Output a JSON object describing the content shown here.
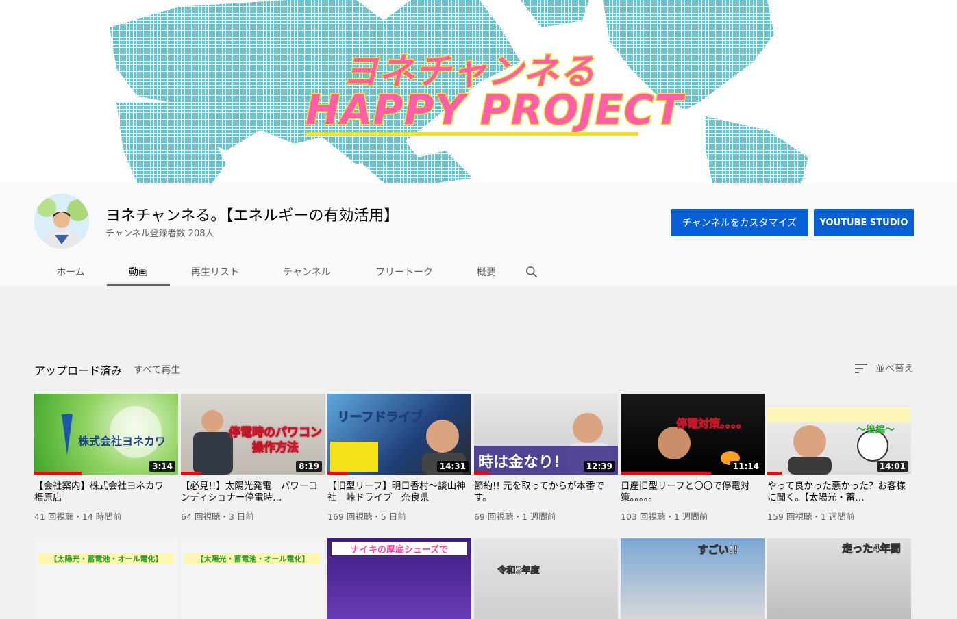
{
  "banner": {
    "line1": "ヨネチャンネる",
    "line2": "HAPPY PROJECT"
  },
  "channel": {
    "title": "ヨネチャンネる。【エネルギーの有効活用】",
    "subscribers": "チャンネル登録者数 208人",
    "customize_label": "チャンネルをカスタマイズ",
    "studio_label": "YOUTUBE STUDIO"
  },
  "tabs": [
    {
      "label": "ホーム"
    },
    {
      "label": "動画"
    },
    {
      "label": "再生リスト"
    },
    {
      "label": "チャンネル"
    },
    {
      "label": "フリートーク"
    },
    {
      "label": "概要"
    }
  ],
  "section": {
    "title": "アップロード済み",
    "play_all": "すべて再生",
    "sort_label": "並べ替え"
  },
  "videos": [
    {
      "title": "【会社案内】株式会社ヨネカワ 橿原店",
      "duration": "3:14",
      "meta": "41 回視聴・14 時間前",
      "progress": 0.33,
      "thumb_text": "株式会社ヨネカワ"
    },
    {
      "title": "【必見!!】太陽光発電　パワーコンディショナー停電時…",
      "duration": "8:19",
      "meta": "64 回視聴・3 日前",
      "progress": 0.14,
      "thumb_text": "停電時のパワコン操作方法"
    },
    {
      "title": "【旧型リーフ】明日香村〜談山神社　峠ドライブ　奈良県",
      "duration": "14:31",
      "meta": "169 回視聴・5 日前",
      "progress": 0.14,
      "thumb_text": "リーフドライブ"
    },
    {
      "title": "節約!! 元を取ってからが本番です。",
      "duration": "12:39",
      "meta": "69 回視聴・1 週間前",
      "progress": 0.1,
      "thumb_text": "時は金なり!"
    },
    {
      "title": "日産旧型リーフと〇〇で停電対策。。。。。",
      "duration": "11:14",
      "meta": "103 回視聴・1 週間前",
      "progress": 0.63,
      "thumb_text": "停電対策。。。。"
    },
    {
      "title": "やって良かった悪かった？お客様に聞く。【太陽光・蓄…",
      "duration": "14:01",
      "meta": "159 回視聴・1 週間前",
      "progress": 0.1,
      "thumb_text": "〜後編〜"
    }
  ],
  "videos_row2": [
    {
      "thumb_text": "【太陽光・蓄電池・オール電化】"
    },
    {
      "thumb_text": "【太陽光・蓄電池・オール電化】"
    },
    {
      "thumb_text": "ナイキの厚底シューズで"
    },
    {
      "thumb_text": "令和2年度"
    },
    {
      "thumb_text": "すごい!!"
    },
    {
      "thumb_text": "走った4年間"
    }
  ],
  "colors": {
    "accent": "#065fd4",
    "progress": "#ff0000",
    "banner_pink": "#ff5fa8",
    "banner_yellow": "#f5e31a",
    "map_teal": "#5cc7d3"
  }
}
